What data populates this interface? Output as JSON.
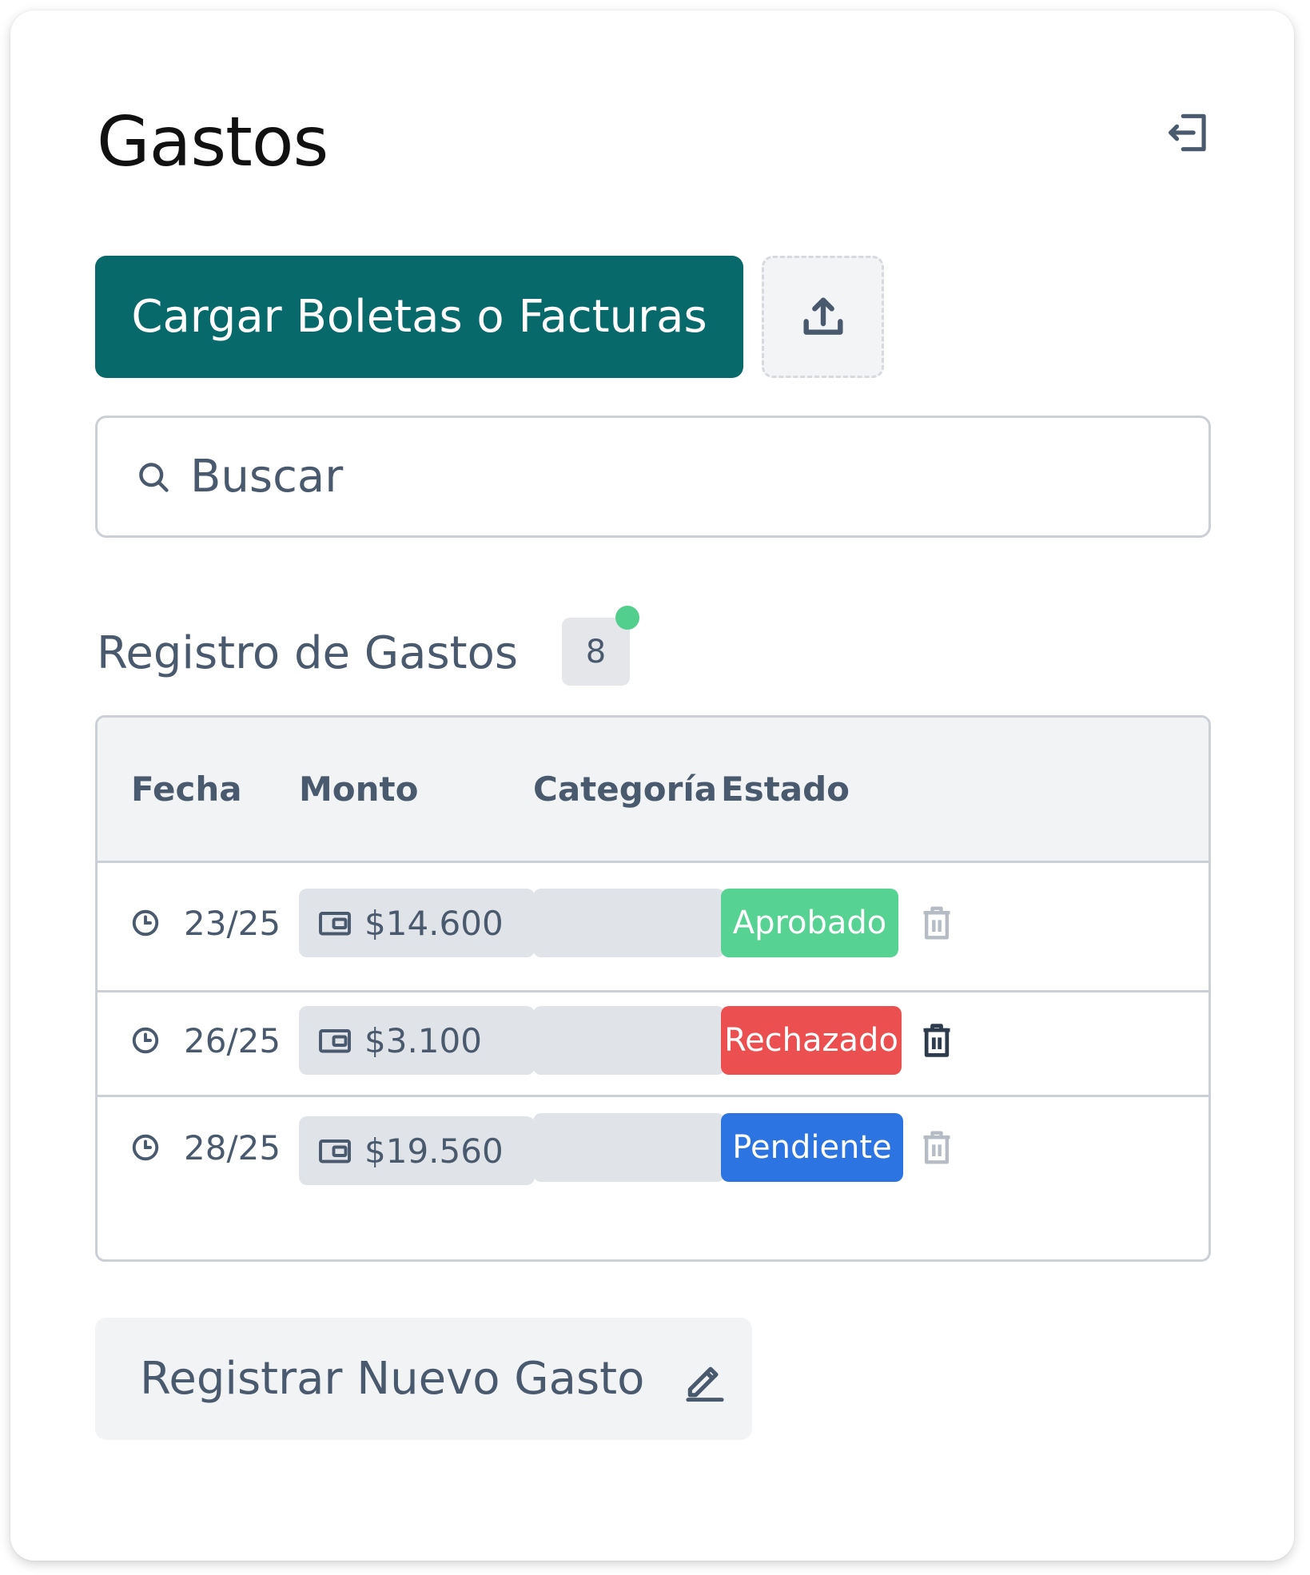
{
  "header": {
    "title": "Gastos",
    "logout_icon": "logout-icon"
  },
  "actions": {
    "upload_label": "Cargar Boletas o Facturas",
    "upload_icon": "upload-icon"
  },
  "search": {
    "placeholder": "Buscar",
    "value": ""
  },
  "registry": {
    "title": "Registro de Gastos",
    "count": "8",
    "indicator_color": "#53cf8d"
  },
  "table": {
    "headers": [
      "Fecha",
      "Monto",
      "Categoría",
      "Estado"
    ],
    "rows": [
      {
        "date": "23/25",
        "amount": "$14.600",
        "category": "",
        "status": "Aprobado",
        "status_color": "#56d293"
      },
      {
        "date": "26/25",
        "amount": "$3.100",
        "category": "",
        "status": "Rechazado",
        "status_color": "#ec4f50"
      },
      {
        "date": "28/25",
        "amount": "$19.560",
        "category": "",
        "status": "Pendiente",
        "status_color": "#2b74e2"
      }
    ]
  },
  "new_expense": {
    "label": "Registrar Nuevo Gasto",
    "icon": "pencil-icon"
  },
  "colors": {
    "primary": "#07696a",
    "text": "#4a5a6e",
    "border": "#cbd0d7",
    "muted_bg": "#f2f3f5"
  }
}
